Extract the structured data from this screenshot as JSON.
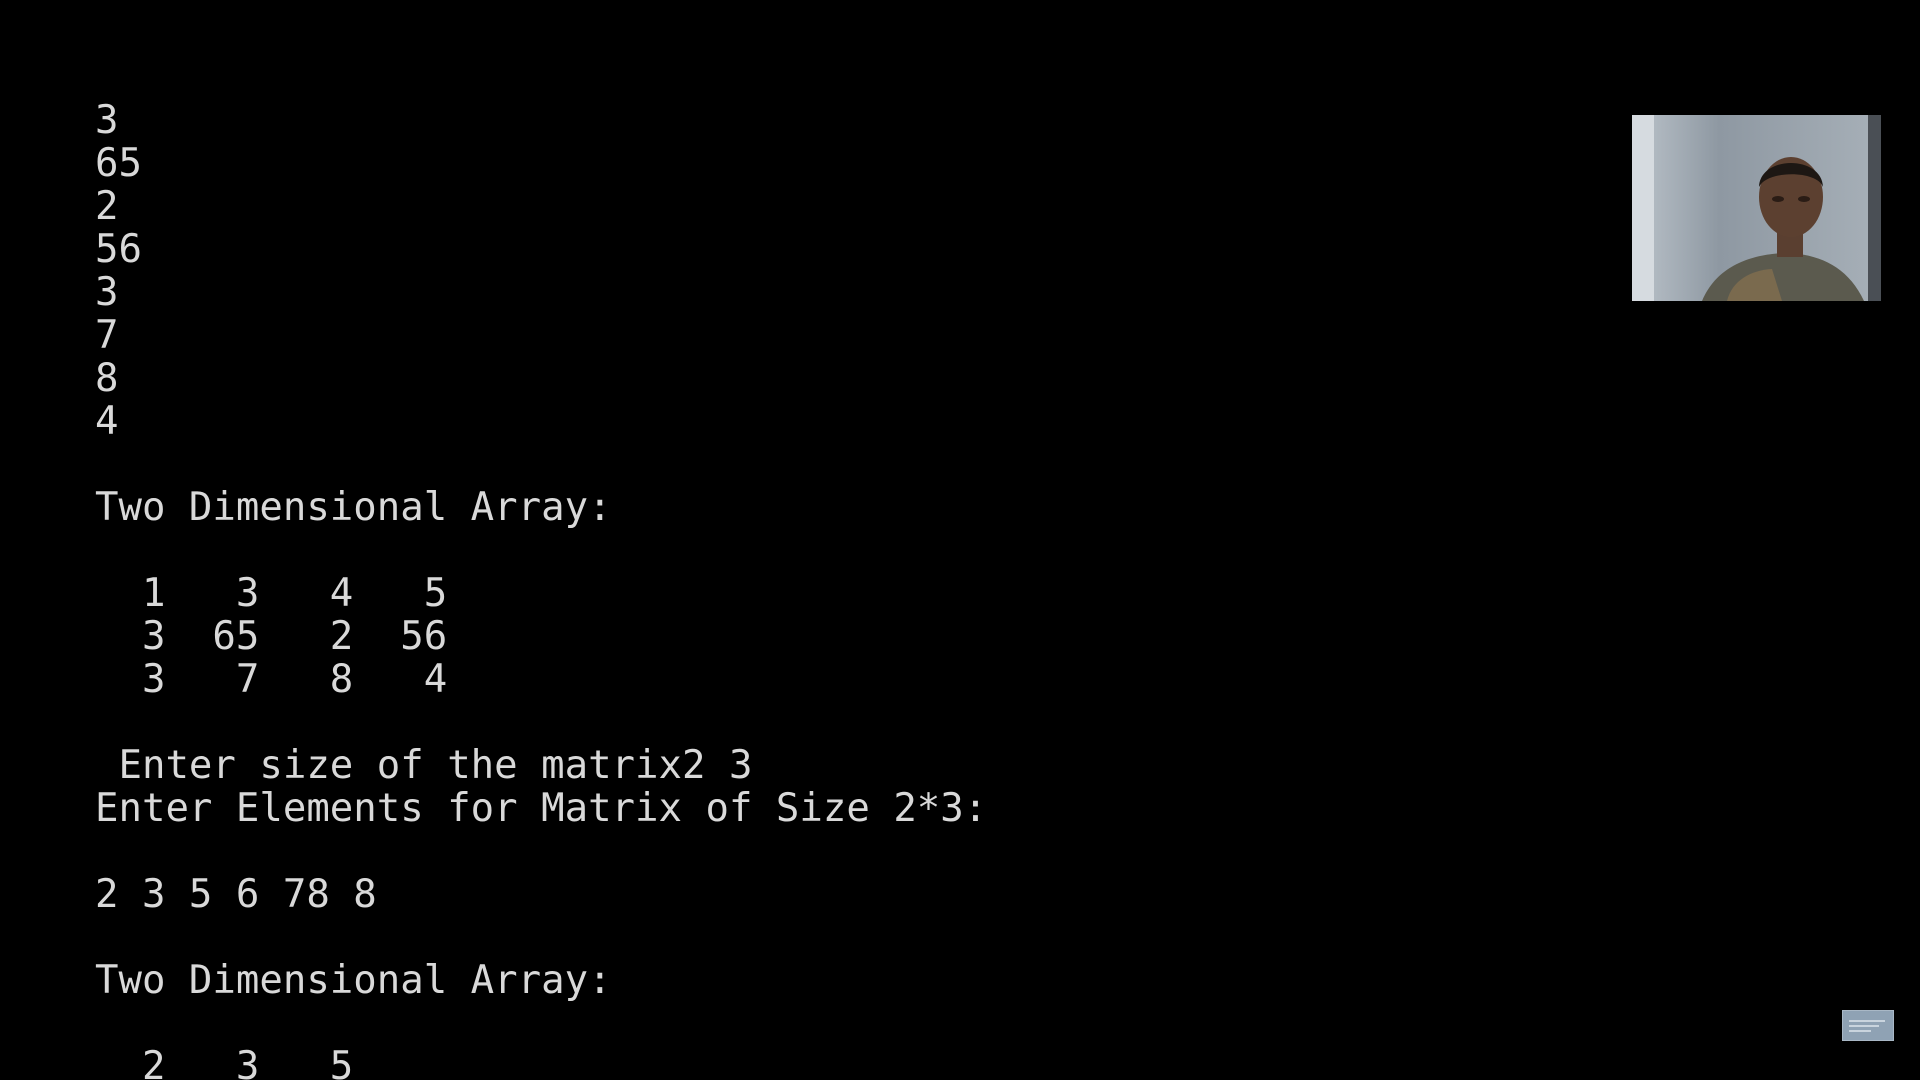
{
  "console": {
    "lines": [
      "3",
      "65",
      "2",
      "56",
      "3",
      "7",
      "8",
      "4",
      "",
      "Two Dimensional Array:",
      "",
      "  1   3   4   5",
      "  3  65   2  56",
      "  3   7   8   4",
      "",
      " Enter size of the matrix2 3",
      "Enter Elements for Matrix of Size 2*3:",
      "",
      "2 3 5 6 78 8",
      "",
      "Two Dimensional Array:",
      "",
      "  2   3   5"
    ]
  },
  "colors": {
    "background": "#000000",
    "text": "#d9d9d9"
  },
  "overlay": {
    "webcam_icon": "presenter-webcam-icon",
    "badge_icon": "video-player-badge-icon"
  }
}
